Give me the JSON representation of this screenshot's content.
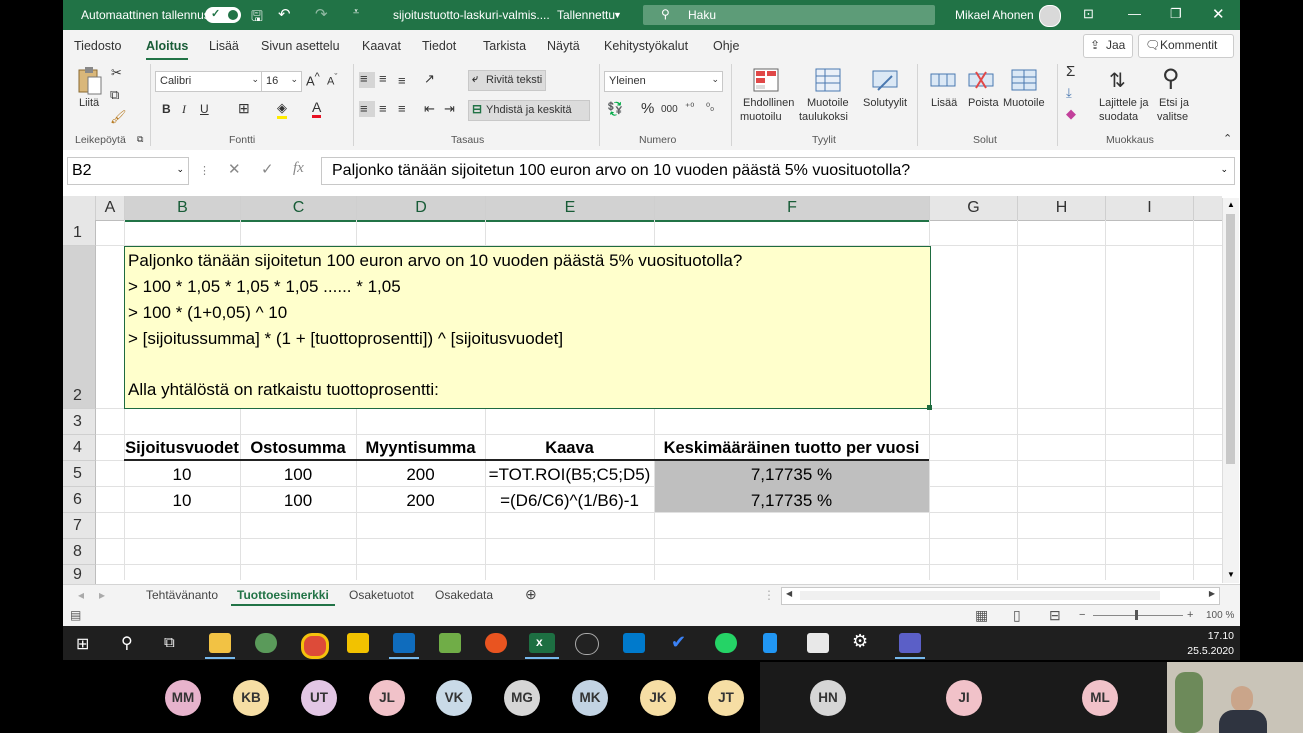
{
  "titlebar": {
    "autosave_label": "Automaattinen tallennus",
    "filename": "sijoitustuotto-laskuri-valmis....",
    "saved_status": "Tallennettu",
    "search_placeholder": "Haku",
    "user": "Mikael Ahonen",
    "brand_color": "#217346"
  },
  "menu": {
    "tabs": [
      "Tiedosto",
      "Aloitus",
      "Lisää",
      "Sivun asettelu",
      "Kaavat",
      "Tiedot",
      "Tarkista",
      "Näytä",
      "Kehitystyökalut",
      "Ohje"
    ],
    "active_tab": "Aloitus",
    "share": "Jaa",
    "comments": "Kommentit"
  },
  "ribbon": {
    "paste": "Liitä",
    "clipboard_group": "Leikepöytä",
    "font_name": "Calibri",
    "font_size": "16",
    "font_group": "Fontti",
    "bold": "B",
    "italic": "I",
    "underline": "U",
    "wrap_text": "Rivitä teksti",
    "merge_center": "Yhdistä ja keskitä",
    "alignment_group": "Tasaus",
    "number_format": "Yleinen",
    "percent": "%",
    "thousands": "000",
    "number_group": "Numero",
    "conditional_1": "Ehdollinen",
    "conditional_2": "muotoilu",
    "format_table_1": "Muotoile",
    "format_table_2": "taulukoksi",
    "cell_styles": "Solutyylit",
    "styles_group": "Tyylit",
    "insert": "Lisää",
    "delete": "Poista",
    "format": "Muotoile",
    "cells_group": "Solut",
    "sort_filter_1": "Lajittele ja",
    "sort_filter_2": "suodata",
    "find_select_1": "Etsi ja",
    "find_select_2": "valitse",
    "editing_group": "Muokkaus"
  },
  "formula_bar": {
    "name_box": "B2",
    "fx": "fx",
    "content": "Paljonko tänään sijoitetun 100 euron arvo on 10 vuoden päästä 5% vuosituotolla?"
  },
  "grid": {
    "columns": [
      "A",
      "B",
      "C",
      "D",
      "E",
      "F",
      "G",
      "H",
      "I"
    ],
    "rows": [
      "1",
      "2",
      "3",
      "4",
      "5",
      "6",
      "7",
      "8",
      "9"
    ],
    "note_lines": [
      "Paljonko tänään sijoitetun 100 euron arvo on 10 vuoden päästä 5% vuosituotolla?",
      "> 100 * 1,05 * 1,05 * 1,05 ...... * 1,05",
      "> 100 * (1+0,05) ^ 10",
      "> [sijoitussumma] * (1 + [tuottoprosentti]) ^ [sijoitusvuodet]",
      "",
      "Alla yhtälöstä on ratkaistu tuottoprosentti:"
    ],
    "table_headers": [
      "Sijoitusvuodet",
      "Ostosumma",
      "Myyntisumma",
      "Kaava",
      "Keskimääräinen tuotto per vuosi"
    ],
    "table_rows": [
      [
        "10",
        "100",
        "200",
        "=TOT.ROI(B5;C5;D5)",
        "7,17735 %"
      ],
      [
        "10",
        "100",
        "200",
        "=(D6/C6)^(1/B6)-1",
        "7,17735 %"
      ]
    ]
  },
  "sheets": {
    "tabs": [
      "Tehtävänanto",
      "Tuottoesimerkki",
      "Osaketuotot",
      "Osakedata"
    ],
    "active": "Tuottoesimerkki"
  },
  "status": {
    "zoom": "100 %"
  },
  "taskbar": {
    "time": "17.10",
    "date": "25.5.2020"
  },
  "participants": [
    "MM",
    "KB",
    "UT",
    "JL",
    "VK",
    "MG",
    "MK",
    "JK",
    "JT",
    "HN",
    "JI",
    "ML"
  ]
}
